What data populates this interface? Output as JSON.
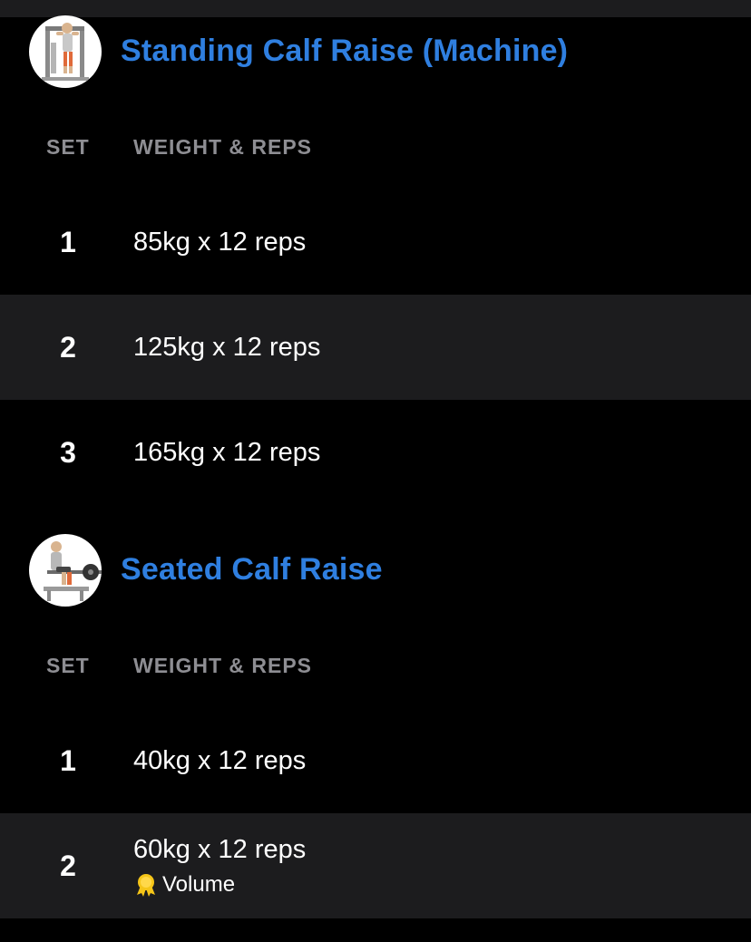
{
  "theme": {
    "background": "#000000",
    "alt_row": "#1c1c1e",
    "accent": "#2f7fe0",
    "header_text": "#8e8e93",
    "text": "#ffffff",
    "medal": "#f5c518"
  },
  "columns": {
    "set": "SET",
    "weight_reps": "WEIGHT & REPS"
  },
  "exercises": [
    {
      "title": "Standing Calf Raise (Machine)",
      "thumbnail_icon": "standing-calf-machine-illustration",
      "sets": [
        {
          "number": "1",
          "value": "85kg x 12 reps"
        },
        {
          "number": "2",
          "value": "125kg x 12 reps"
        },
        {
          "number": "3",
          "value": "165kg x 12 reps"
        }
      ]
    },
    {
      "title": "Seated Calf Raise",
      "thumbnail_icon": "seated-calf-machine-illustration",
      "sets": [
        {
          "number": "1",
          "value": "40kg x 12 reps"
        },
        {
          "number": "2",
          "value": "60kg x 12 reps",
          "badge": {
            "icon": "medal-icon",
            "label": "Volume"
          }
        }
      ]
    }
  ]
}
